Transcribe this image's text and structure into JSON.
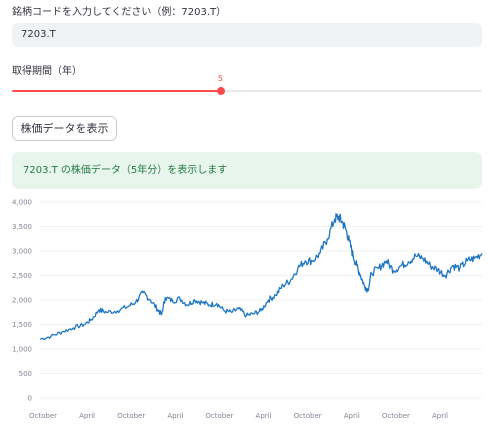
{
  "ticker": {
    "label": "銘柄コードを入力してください（例：7203.T）",
    "value": "7203.T"
  },
  "period": {
    "label": "取得期間（年）",
    "value": "5",
    "min": 1,
    "max": 10
  },
  "button": {
    "label": "株価データを表示"
  },
  "message": {
    "text": "7203.T の株価データ（5年分）を表示します"
  },
  "colors": {
    "line": "#1f77c4",
    "accent": "#ff4b4b",
    "success_bg": "#e8f5ec",
    "success_text": "#207a42"
  },
  "chart_data": {
    "type": "line",
    "title": "",
    "xlabel": "",
    "ylabel": "",
    "ylim": [
      0,
      4000
    ],
    "yticks": [
      "0",
      "500",
      "1,000",
      "1,500",
      "2,000",
      "2,500",
      "3,000",
      "3,500",
      "4,000"
    ],
    "xticks": [
      "October",
      "April",
      "October",
      "April",
      "October",
      "April",
      "October",
      "April",
      "October",
      "April"
    ],
    "x_range": [
      0,
      60
    ],
    "series": [
      {
        "x": [
          0,
          1.5,
          3,
          4.5,
          6,
          7,
          8,
          9,
          10.5,
          12,
          13,
          14,
          15,
          16,
          16.5,
          17,
          18,
          19,
          20,
          21,
          22,
          23,
          24,
          25,
          26,
          27,
          28,
          29,
          30,
          31,
          32,
          33,
          34,
          35,
          36,
          37,
          38,
          39,
          40,
          40.5,
          41,
          41.5,
          42,
          42.5,
          43,
          43.5,
          44,
          44.5,
          45,
          46,
          47,
          48,
          49,
          50,
          51,
          52,
          53,
          54,
          55,
          56,
          57,
          58,
          59,
          60
        ],
        "values": [
          1200,
          1260,
          1350,
          1430,
          1500,
          1600,
          1800,
          1750,
          1780,
          1870,
          1960,
          2150,
          2000,
          1800,
          1700,
          2050,
          1980,
          2030,
          1900,
          2000,
          1950,
          1900,
          1930,
          1780,
          1750,
          1820,
          1680,
          1720,
          1780,
          2000,
          2100,
          2300,
          2400,
          2650,
          2800,
          2800,
          2950,
          3250,
          3650,
          3700,
          3600,
          3450,
          3200,
          2900,
          2700,
          2500,
          2300,
          2200,
          2550,
          2650,
          2800,
          2600,
          2700,
          2780,
          2900,
          2850,
          2700,
          2620,
          2500,
          2700,
          2650,
          2800,
          2850,
          2950
        ]
      }
    ]
  }
}
